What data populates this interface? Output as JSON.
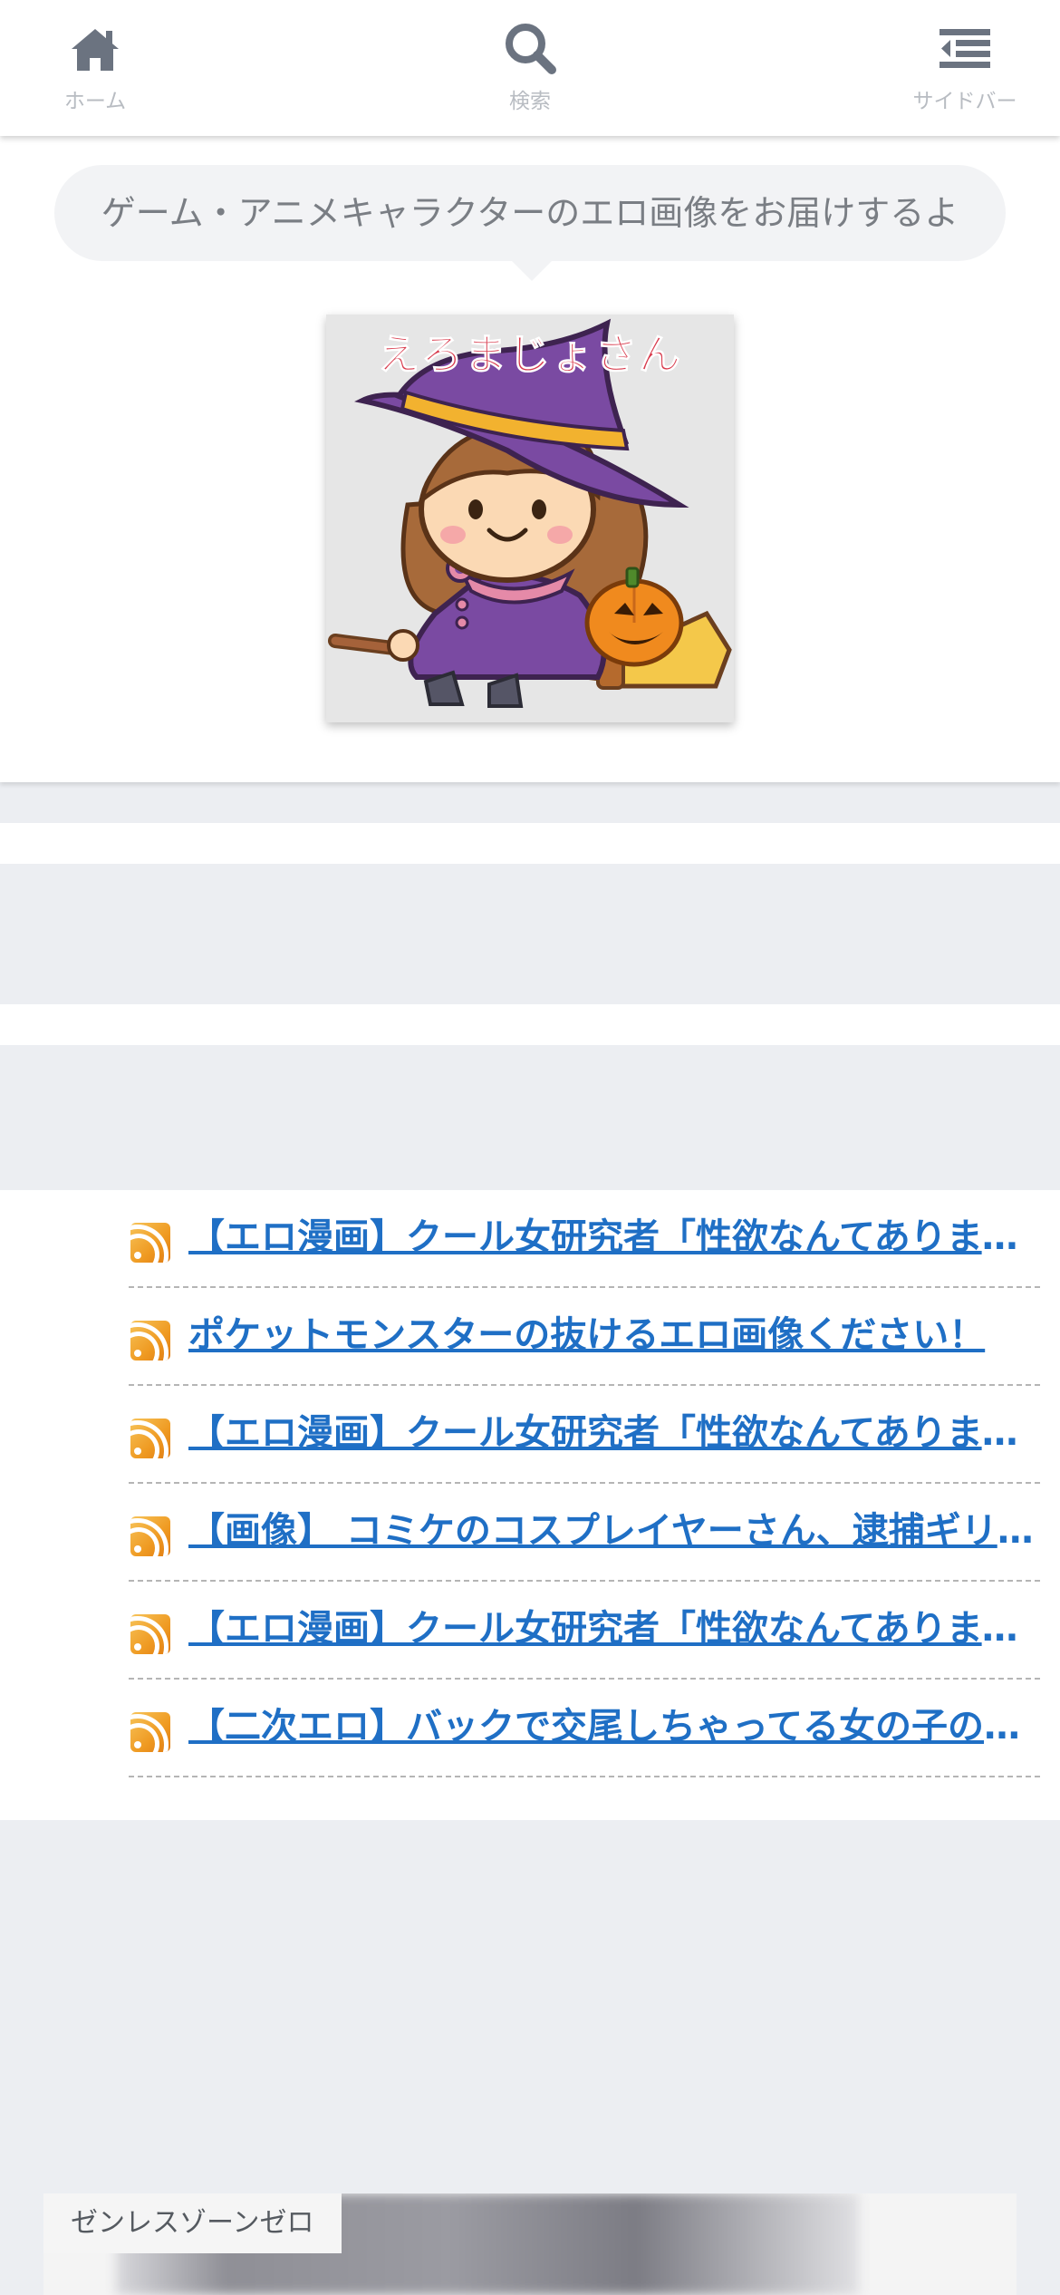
{
  "nav": {
    "home": {
      "label": "ホーム",
      "icon": "home-icon"
    },
    "search": {
      "label": "検索",
      "icon": "search-icon"
    },
    "sidebar": {
      "label": "サイドバー",
      "icon": "sidebar-menu-icon"
    }
  },
  "header": {
    "tagline": "ゲーム・アニメキャラクターのエロ画像をお届けするよ",
    "logo_text": "えろまじょさん"
  },
  "rss": {
    "items": [
      {
        "title": "【エロ漫画】クール女研究者「性欲なんてありません」"
      },
      {
        "title": "ポケットモンスターの抜けるエロ画像ください！"
      },
      {
        "title": "【エロ漫画】クール女研究者「性欲なんてありません」"
      },
      {
        "title": "【画像】 コミケのコスプレイヤーさん、逮捕ギリギリ"
      },
      {
        "title": "【エロ漫画】クール女研究者「性欲なんてありません」"
      },
      {
        "title": "【二次エロ】バックで交尾しちゃってる女の子のエロ画像"
      }
    ]
  },
  "bottom_card": {
    "label": "ゼンレスゾーンゼロ"
  },
  "colors": {
    "link": "#1f6fc5",
    "nav_icon": "#6b7380",
    "page_bg": "#eceef2",
    "logo_text": "#d83a4c"
  }
}
